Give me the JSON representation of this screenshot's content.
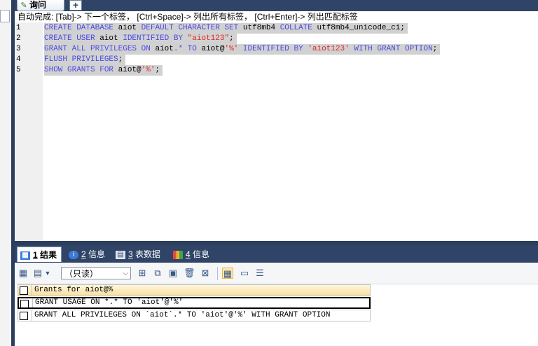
{
  "query_tab": {
    "label": "询问",
    "icon": "query-icon"
  },
  "add_tab": {
    "label": "+"
  },
  "hint": "自动完成: [Tab]-> 下一个标签， [Ctrl+Space]-> 列出所有标签， [Ctrl+Enter]-> 列出匹配标签",
  "editor": {
    "lines": [
      {
        "num": "1",
        "tokens": [
          {
            "t": "CREATE DATABASE ",
            "c": "kw"
          },
          {
            "t": "aiot ",
            "c": "plain"
          },
          {
            "t": "DEFAULT CHARACTER SET ",
            "c": "kw"
          },
          {
            "t": "utf8mb4 ",
            "c": "plain"
          },
          {
            "t": "COLLATE ",
            "c": "kw"
          },
          {
            "t": "utf8mb4_unicode_ci;",
            "c": "plain"
          }
        ]
      },
      {
        "num": "2",
        "tokens": [
          {
            "t": "CREATE USER ",
            "c": "kw"
          },
          {
            "t": "aiot ",
            "c": "plain"
          },
          {
            "t": "IDENTIFIED BY ",
            "c": "kw"
          },
          {
            "t": "\"aiot123\"",
            "c": "str"
          },
          {
            "t": ";",
            "c": "plain"
          }
        ]
      },
      {
        "num": "3",
        "tokens": [
          {
            "t": "GRANT ALL PRIVILEGES ON ",
            "c": "kw"
          },
          {
            "t": "aiot",
            "c": "plain"
          },
          {
            "t": ".* ",
            "c": "kw"
          },
          {
            "t": "TO ",
            "c": "kw"
          },
          {
            "t": "aiot@",
            "c": "plain"
          },
          {
            "t": "'%'",
            "c": "str"
          },
          {
            "t": " IDENTIFIED BY ",
            "c": "kw"
          },
          {
            "t": "'aiot123'",
            "c": "str"
          },
          {
            "t": " WITH GRANT OPTION",
            "c": "kw"
          },
          {
            "t": ";",
            "c": "plain"
          }
        ]
      },
      {
        "num": "4",
        "tokens": [
          {
            "t": "FLUSH PRIVILEGES",
            "c": "kw"
          },
          {
            "t": ";",
            "c": "plain"
          }
        ]
      },
      {
        "num": "5",
        "tokens": [
          {
            "t": "SHOW GRANTS FOR ",
            "c": "kw"
          },
          {
            "t": "aiot@",
            "c": "plain"
          },
          {
            "t": "'%'",
            "c": "str"
          },
          {
            "t": ";",
            "c": "plain"
          }
        ]
      }
    ]
  },
  "result_tabs": [
    {
      "num": "1",
      "label": "结果",
      "icon": "grid-icon",
      "active": true
    },
    {
      "num": "2",
      "label": "信息",
      "icon": "info-icon",
      "active": false
    },
    {
      "num": "3",
      "label": "表数据",
      "icon": "table-icon",
      "active": false
    },
    {
      "num": "4",
      "label": "信息",
      "icon": "chart-icon",
      "active": false
    }
  ],
  "toolbar": {
    "readonly_select": "（只读）"
  },
  "grid": {
    "header": "Grants for aiot@%",
    "rows": [
      "GRANT USAGE ON *.* TO 'aiot'@'%'",
      "GRANT ALL PRIVILEGES ON `aiot`.* TO 'aiot'@'%' WITH GRANT OPTION"
    ]
  },
  "colors": {
    "frame": "#2f4466",
    "keyword": "#4a4ae6",
    "string": "#e02828",
    "header_bg": "#f8dfa0"
  }
}
